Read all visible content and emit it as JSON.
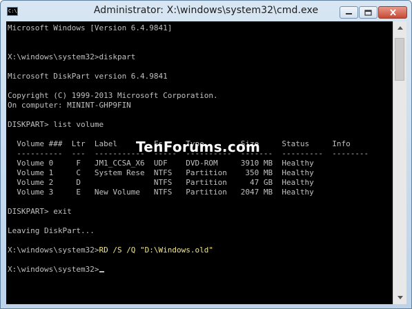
{
  "window": {
    "title": "Administrator: X:\\windows\\system32\\cmd.exe",
    "icon_text": "C:\\."
  },
  "controls": {
    "minimize": "minimize-icon",
    "maximize": "maximize-icon",
    "close": "close-icon"
  },
  "console": {
    "lines": {
      "l1": "Microsoft Windows [Version 6.4.9841]",
      "l2": "X:\\windows\\system32>diskpart",
      "l3": "Microsoft DiskPart version 6.4.9841",
      "l4": "Copyright (C) 1999-2013 Microsoft Corporation.",
      "l5": "On computer: MININT-GHP9FIN",
      "l6": "DISKPART> list volume",
      "l7": "  Volume ###  Ltr  Label        Fs     Type        Size     Status     Info",
      "l8": "  ----------  ---  -----------  -----  ----------  -------  ---------  --------",
      "l9": "  Volume 0     F   JM1_CCSA_X6  UDF    DVD-ROM     3910 MB  Healthy",
      "l10": "  Volume 1     C   System Rese  NTFS   Partition    350 MB  Healthy",
      "l11": "  Volume 2     D                NTFS   Partition     47 GB  Healthy",
      "l12": "  Volume 3     E   New Volume   NTFS   Partition   2047 MB  Healthy",
      "l13": "DISKPART> exit",
      "l14": "Leaving DiskPart...",
      "l15_prompt": "X:\\windows\\system32>",
      "l15_cmd": "RD /S /Q \"D:\\Windows.old\"",
      "l16": "X:\\windows\\system32>"
    },
    "watermark": "TenForums.com"
  }
}
